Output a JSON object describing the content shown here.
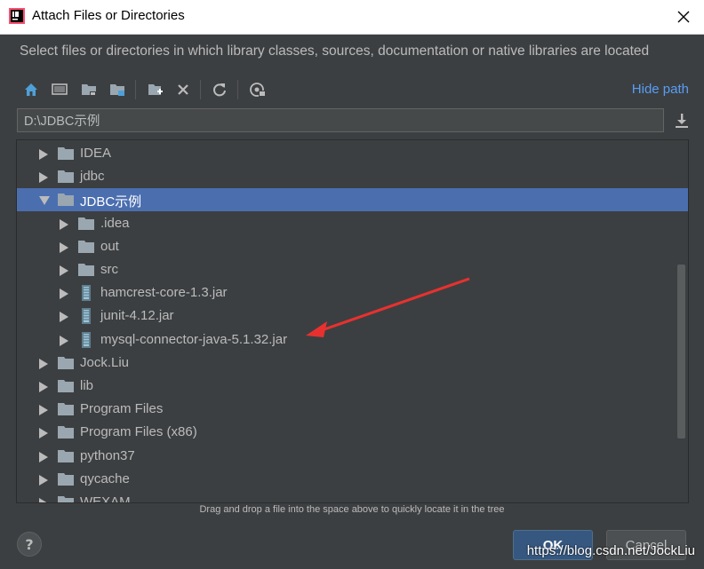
{
  "window": {
    "title": "Attach Files or Directories",
    "description": "Select files or directories in which library classes, sources, documentation or native libraries are located"
  },
  "toolbar": {
    "buttons": [
      "home-icon",
      "desktop-icon",
      "project-folder-icon",
      "module-folder-icon",
      "new-folder-icon",
      "delete-icon",
      "refresh-icon",
      "show-hidden-icon"
    ],
    "hide_path_label": "Hide path"
  },
  "path": {
    "value": "D:\\JDBC示例"
  },
  "tree": {
    "items": [
      {
        "label": "IDEA",
        "type": "folder",
        "level": 0,
        "expanded": false
      },
      {
        "label": "jdbc",
        "type": "folder",
        "level": 0,
        "expanded": false
      },
      {
        "label": "JDBC示例",
        "type": "folder",
        "level": 0,
        "expanded": true,
        "selected": true
      },
      {
        "label": ".idea",
        "type": "folder",
        "level": 1,
        "expanded": false
      },
      {
        "label": "out",
        "type": "folder",
        "level": 1,
        "expanded": false
      },
      {
        "label": "src",
        "type": "folder",
        "level": 1,
        "expanded": false
      },
      {
        "label": "hamcrest-core-1.3.jar",
        "type": "jar",
        "level": 1,
        "expanded": false
      },
      {
        "label": "junit-4.12.jar",
        "type": "jar",
        "level": 1,
        "expanded": false
      },
      {
        "label": "mysql-connector-java-5.1.32.jar",
        "type": "jar",
        "level": 1,
        "expanded": false
      },
      {
        "label": "Jock.Liu",
        "type": "folder",
        "level": 0,
        "expanded": false
      },
      {
        "label": "lib",
        "type": "folder",
        "level": 0,
        "expanded": false
      },
      {
        "label": "Program Files",
        "type": "folder",
        "level": 0,
        "expanded": false
      },
      {
        "label": "Program Files (x86)",
        "type": "folder",
        "level": 0,
        "expanded": false
      },
      {
        "label": "python37",
        "type": "folder",
        "level": 0,
        "expanded": false
      },
      {
        "label": "qycache",
        "type": "folder",
        "level": 0,
        "expanded": false
      },
      {
        "label": "WEXAM",
        "type": "folder",
        "level": 0,
        "expanded": false
      }
    ]
  },
  "hint": "Drag and drop a file into the space above to quickly locate it in the tree",
  "footer": {
    "help_label": "?",
    "ok_label": "OK",
    "cancel_label": "Cancel"
  },
  "watermark": "https://blog.csdn.net/JockLiu",
  "colors": {
    "background": "#3c3f41",
    "selection": "#4b6eaf",
    "link": "#589df6",
    "annotation_arrow": "#e8312f"
  }
}
